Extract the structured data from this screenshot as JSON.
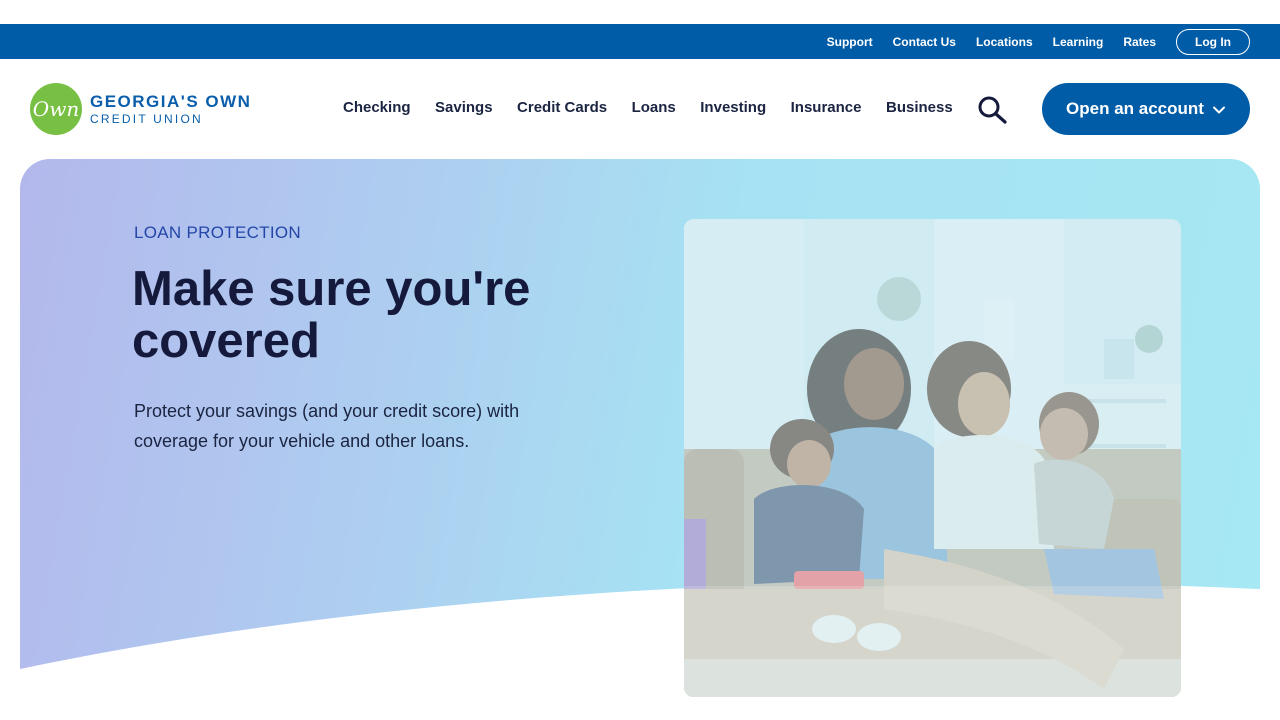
{
  "utility_nav": {
    "links": [
      "Support",
      "Contact Us",
      "Locations",
      "Learning",
      "Rates"
    ],
    "login_label": "Log In"
  },
  "brand": {
    "mark": "Own",
    "name_line1": "GEORGIA'S OWN",
    "name_line2": "CREDIT UNION"
  },
  "main_nav": {
    "items": [
      "Checking",
      "Savings",
      "Credit Cards",
      "Loans",
      "Investing",
      "Insurance",
      "Business"
    ],
    "search_icon": "search-icon",
    "cta_label": "Open an account",
    "cta_icon": "chevron-down-icon"
  },
  "hero": {
    "eyebrow": "LOAN PROTECTION",
    "title": "Make sure you're covered",
    "description": "Protect your savings (and your credit score) with coverage for your vehicle and other loans.",
    "image_subject": "family-on-couch-photo"
  },
  "colors": {
    "brand_blue": "#005ca7",
    "logo_green": "#78c043",
    "hero_gradient_start": "#b3b8ec",
    "hero_gradient_end": "#a6e8f3",
    "heading": "#151a3c"
  }
}
